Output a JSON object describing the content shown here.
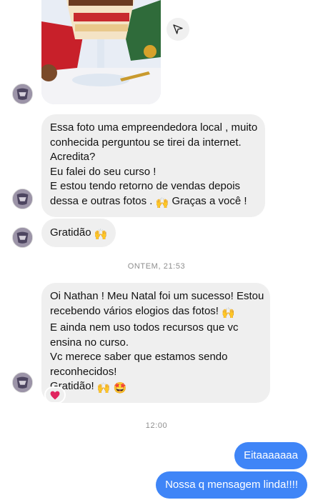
{
  "thread": {
    "messages_in": [
      {
        "lines": [
          "Essa foto uma empreendedora local , muito",
          "conhecida perguntou se tirei da internet.",
          "Acredita?",
          "Eu falei do seu curso !",
          "E estou tendo retorno de vendas depois"
        ],
        "last_line_prefix": "dessa e outras fotos .",
        "last_line_suffix": "Graças a você !"
      },
      {
        "text": "Gratidão"
      },
      {
        "line1_prefix": "Oi Nathan ! Meu Natal foi um sucesso! Estou",
        "line2_prefix": "recebendo vários elogios das fotos!",
        "lines_mid": [
          "E ainda nem uso todos recursos que vc",
          "ensina no curso.",
          "Vc merece saber que estamos sendo",
          "reconhecidos!"
        ],
        "last_line_prefix": "Gratidão!"
      }
    ],
    "timestamps": [
      "ONTEM, 21:53",
      "12:00"
    ],
    "messages_out": [
      "Eitaaaaaaa",
      "Nossa q mensagem linda!!!!"
    ],
    "reaction": "heart-reaction"
  },
  "colors": {
    "incoming_bubble": "#efefef",
    "outgoing_bubble": "#3f85f7",
    "timestamp": "#8e8e8e",
    "reaction_heart": "#e0245e"
  },
  "icons": [
    "share-icon",
    "raising-hands-emoji",
    "grinning-star-eyes-emoji",
    "heart-icon",
    "avatar-image"
  ]
}
